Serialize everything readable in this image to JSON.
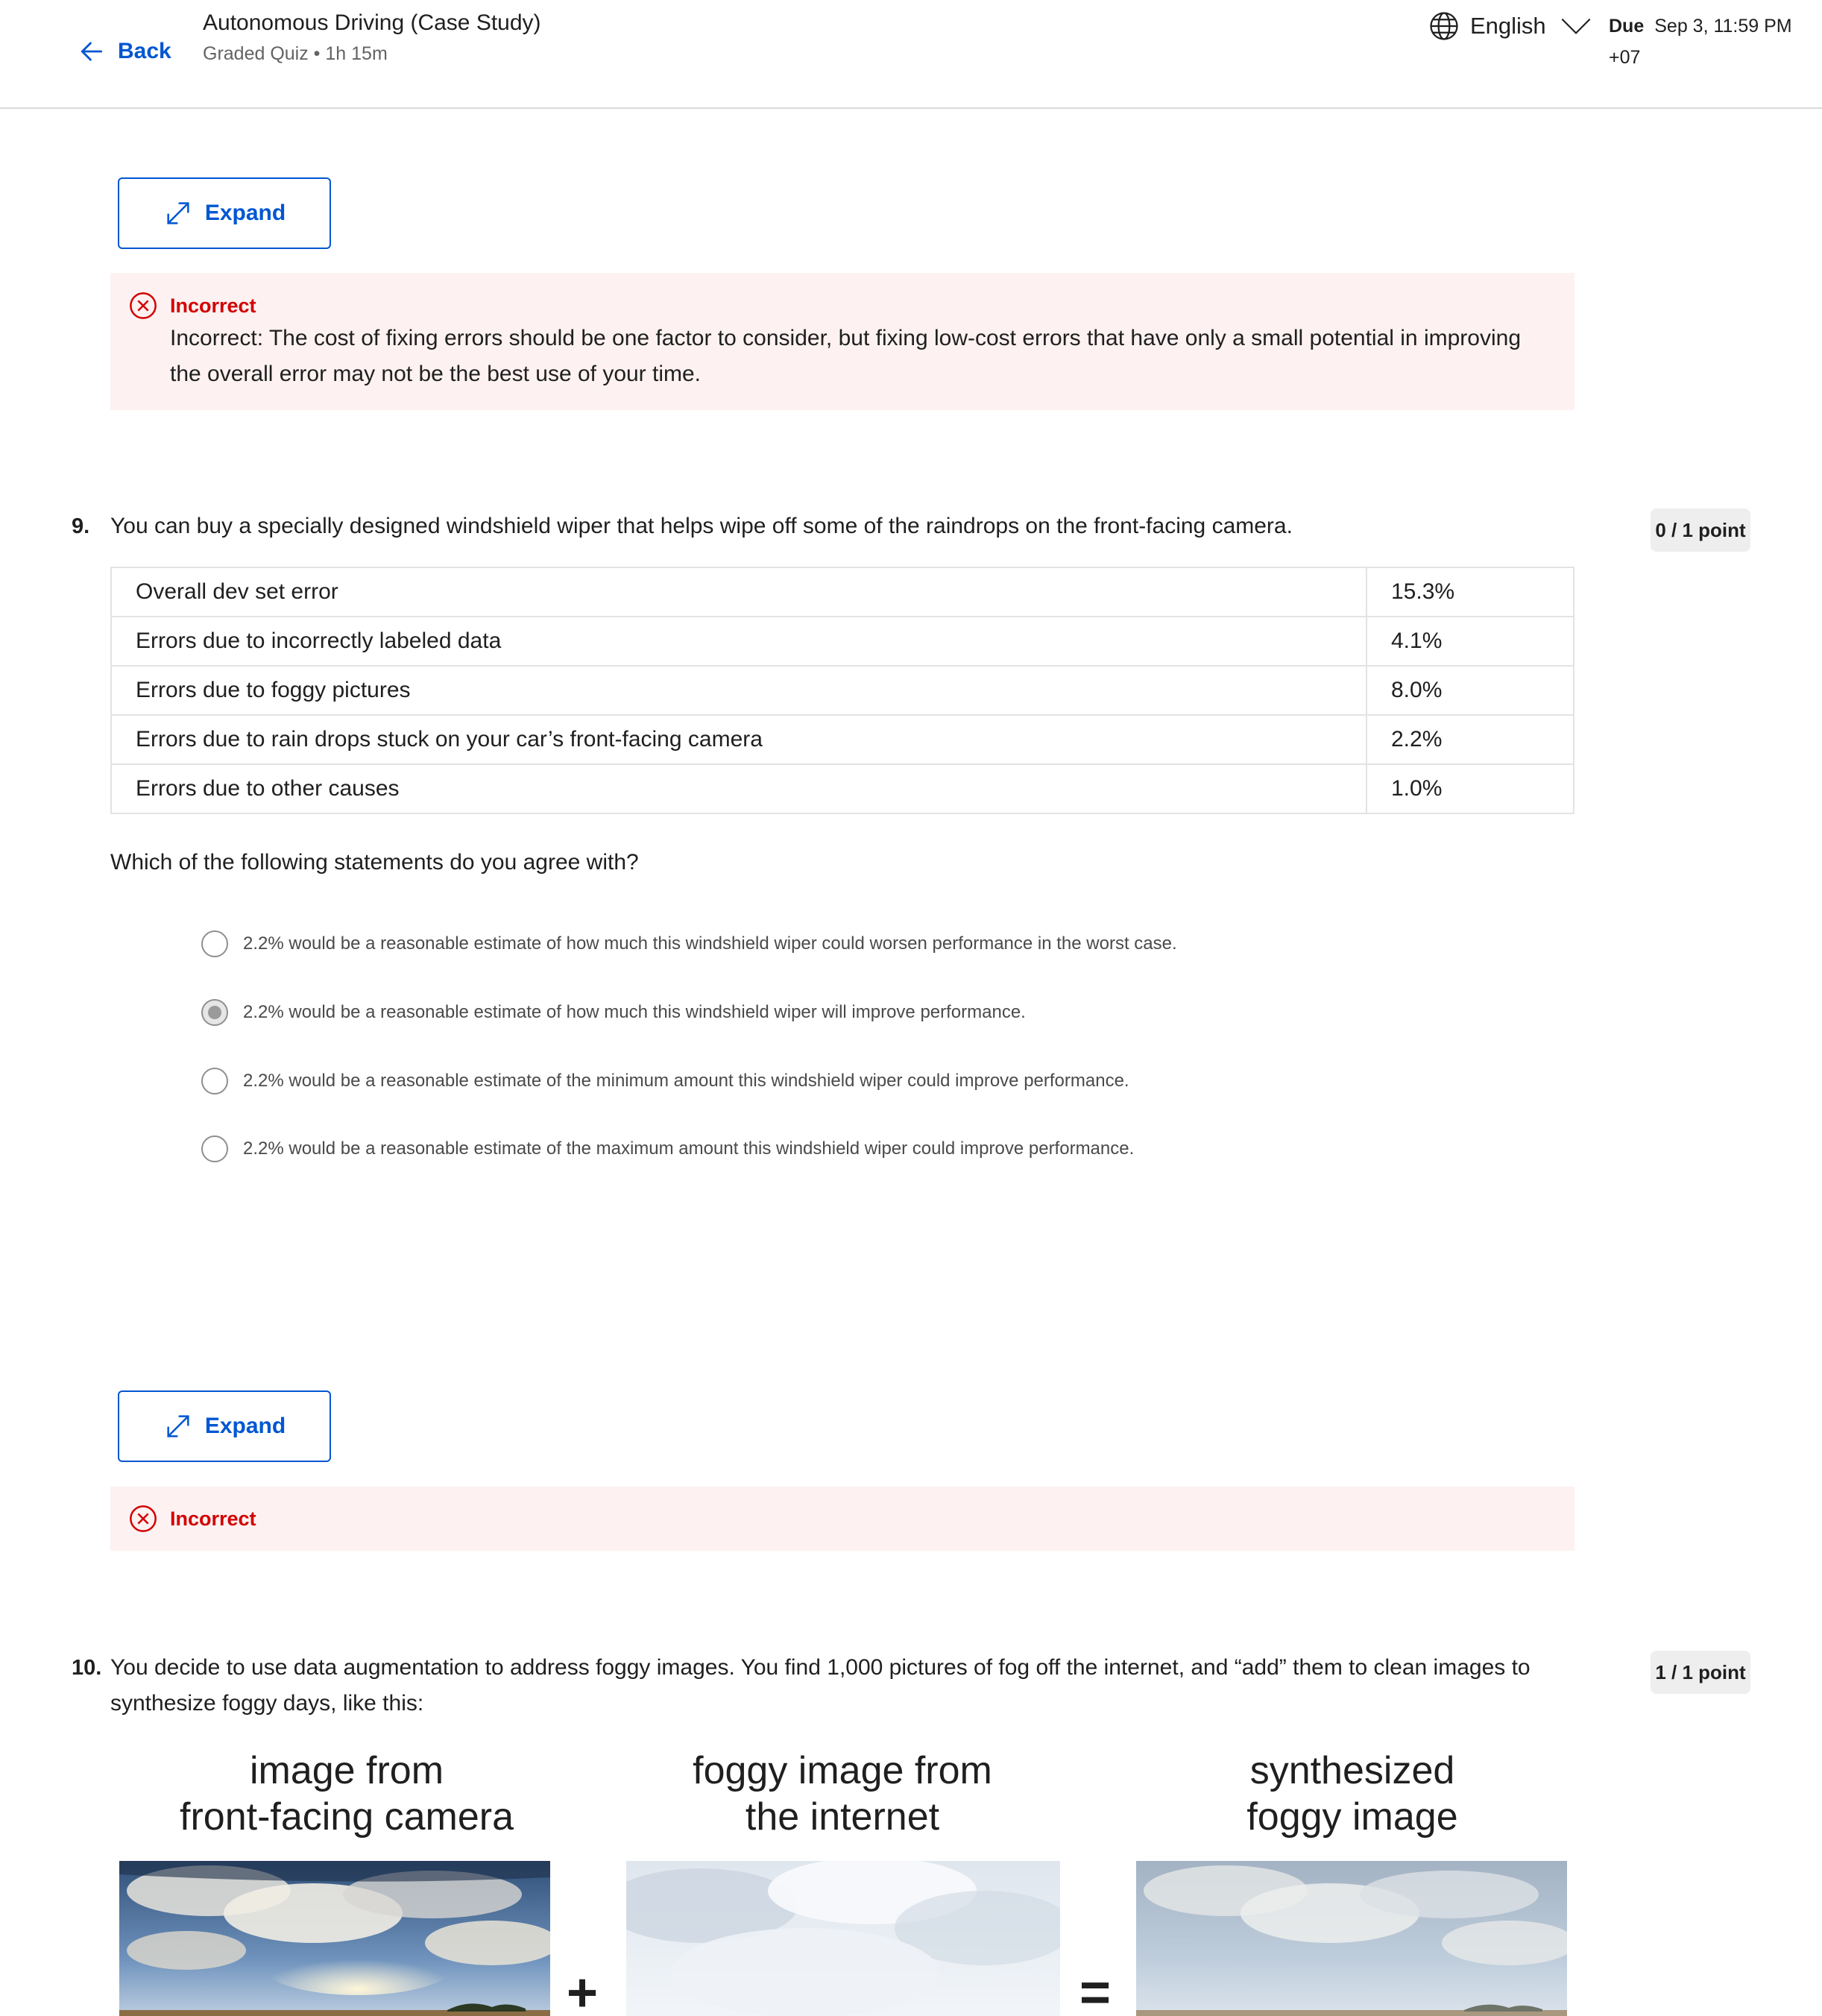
{
  "header": {
    "back_label": "Back",
    "course_title": "Autonomous Driving (Case Study)",
    "course_subtitle": "Graded Quiz • 1h 15m",
    "language": "English",
    "due_label": "Due",
    "due_date": "Sep 3, 11:59 PM",
    "due_tz": "+07"
  },
  "expand_label": "Expand",
  "q8": {
    "feedback_status": "Incorrect",
    "feedback_text": "Incorrect: The cost of fixing errors should be one factor to consider, but fixing low-cost errors that have only a small potential in improving the overall error may not be the best use of your time."
  },
  "q9": {
    "number": "9.",
    "text": "You can buy a specially designed windshield wiper that helps wipe off some of the raindrops on the front-facing camera.",
    "points": "0 / 1 point",
    "table": [
      {
        "label": "Overall dev set error",
        "value": "15.3%"
      },
      {
        "label": "Errors due to incorrectly labeled data",
        "value": "4.1%"
      },
      {
        "label": "Errors due to foggy pictures",
        "value": "8.0%"
      },
      {
        "label": "Errors due to rain drops stuck on your car’s front-facing camera",
        "value": "2.2%"
      },
      {
        "label": "Errors due to other causes",
        "value": "1.0%"
      }
    ],
    "prompt": "Which of the following statements do you agree with?",
    "options": [
      {
        "label": "2.2% would be a reasonable estimate of how much this windshield wiper could worsen performance in the worst case.",
        "selected": false
      },
      {
        "label": "2.2% would be a reasonable estimate of how much this windshield wiper will improve performance.",
        "selected": true
      },
      {
        "label": "2.2% would be a reasonable estimate of the minimum amount this windshield wiper could improve performance.",
        "selected": false
      },
      {
        "label": "2.2% would be a reasonable estimate of the maximum amount this windshield wiper could improve performance.",
        "selected": false
      }
    ],
    "feedback_status": "Incorrect"
  },
  "q10": {
    "number": "10.",
    "text": "You decide to use data augmentation to address foggy images. You find 1,000 pictures of fog off the internet, and “add” them to clean images to synthesize foggy days, like this:",
    "points": "1 / 1 point",
    "captions": [
      {
        "line1": "image from",
        "line2": "front-facing camera"
      },
      {
        "line1": "foggy image from",
        "line2": "the internet"
      },
      {
        "line1": "synthesized",
        "line2": "foggy image"
      }
    ],
    "plus_sign": "+",
    "equals_sign": "="
  },
  "colors": {
    "accent": "#0056d2",
    "error": "#d30001",
    "error_bg": "#fdf1f1"
  }
}
